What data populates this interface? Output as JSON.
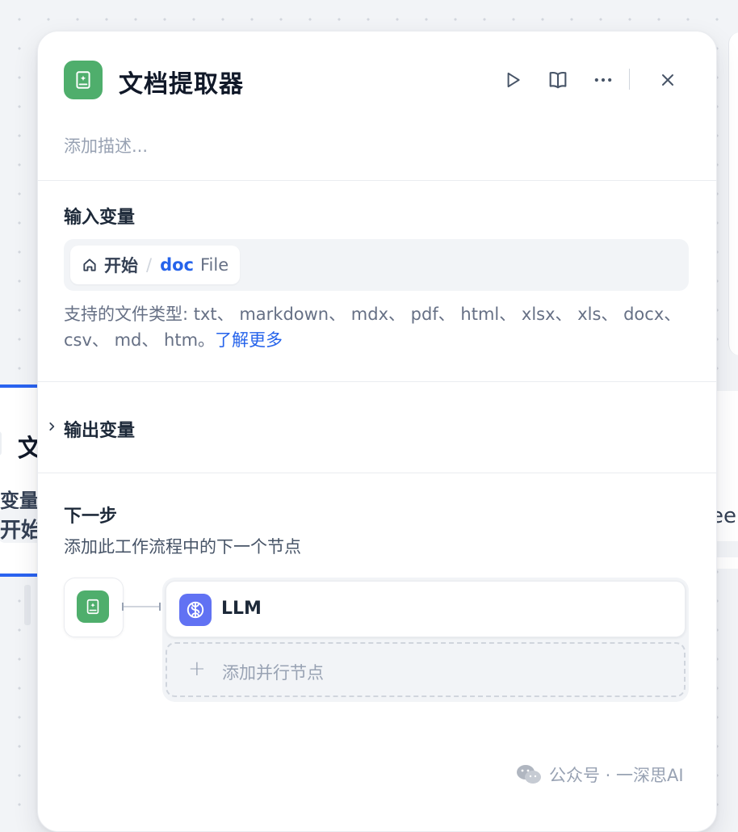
{
  "canvas": {
    "left_node": {
      "title": "文",
      "label": "变量",
      "pill": "开始"
    },
    "right_node": {
      "text": "ee"
    }
  },
  "panel": {
    "title": "文档提取器",
    "description_placeholder": "添加描述...",
    "icons": {
      "app": "document-extractor-icon",
      "run": "play-icon",
      "docs": "book-icon",
      "more": "more-dots-icon",
      "close": "close-icon"
    },
    "input_section": {
      "title": "输入变量",
      "variable": {
        "node": "开始",
        "separator": "/",
        "name": "doc",
        "type": "File"
      },
      "support_text": "支持的文件类型: txt、 markdown、 mdx、 pdf、 html、 xlsx、 xls、 docx、 csv、 md、 htm。",
      "learn_more": "了解更多"
    },
    "output_section": {
      "title": "输出变量"
    },
    "next_step": {
      "title": "下一步",
      "description": "添加此工作流程中的下一个节点",
      "next_node": "LLM",
      "add_parallel": "添加并行节点",
      "plus": "+"
    }
  },
  "colors": {
    "extractor_green": "#4fae6c",
    "llm_indigo": "#6172f3",
    "link_blue": "#2563eb",
    "selection_blue": "#2a63f0"
  },
  "watermark": {
    "text": "公众号 · 一深思AI"
  }
}
